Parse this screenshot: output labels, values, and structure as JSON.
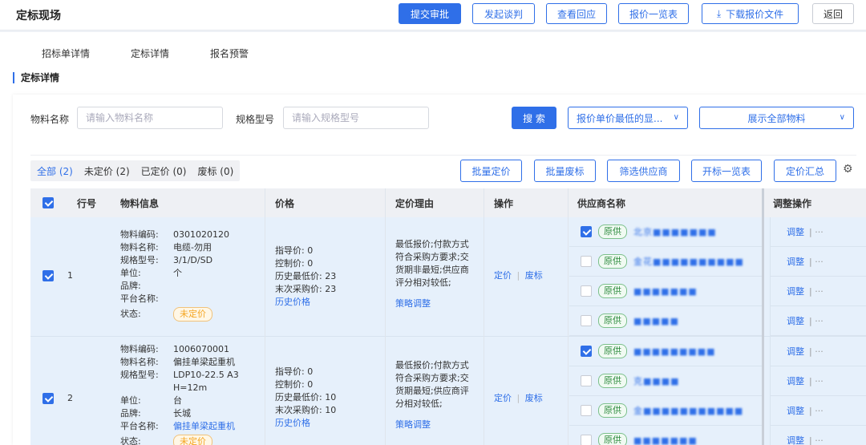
{
  "header": {
    "title": "定标现场",
    "buttons": {
      "submit": "提交审批",
      "negotiate": "发起谈判",
      "view_reply": "查看回应",
      "quote_list": "报价一览表",
      "download": "下载报价文件",
      "back": "返回"
    },
    "download_icon": "⤓"
  },
  "tabs": [
    "招标单详情",
    "定标详情",
    "报名预警"
  ],
  "section_title": "定标详情",
  "search": {
    "material_label": "物料名称",
    "material_placeholder": "请输入物料名称",
    "spec_label": "规格型号",
    "spec_placeholder": "请输入规格型号",
    "search_btn": "搜 索",
    "sort_select": "报价单价最低的显...",
    "show_select": "展示全部物料"
  },
  "filters": {
    "all": "全部 (2)",
    "unpriced": "未定价 (2)",
    "priced": "已定价 (0)",
    "void": "废标 (0)"
  },
  "actions": {
    "batch_price": "批量定价",
    "batch_void": "批量废标",
    "filter_supplier": "筛选供应商",
    "open_list": "开标一览表",
    "price_summary": "定价汇总"
  },
  "columns": {
    "row_no": "行号",
    "material": "物料信息",
    "price": "价格",
    "reason": "定价理由",
    "ops": "操作",
    "supplier": "供应商名称",
    "adjust": "调整操作"
  },
  "labels": {
    "code": "物料编码:",
    "name": "物料名称:",
    "spec": "规格型号:",
    "unit": "单位:",
    "brand": "品牌:",
    "platform": "平台名称:",
    "status": "状态:",
    "guide": "指导价:",
    "control": "控制价:",
    "hist_low": "历史最低价:",
    "last_buy": "末次采购价:",
    "hist_link": "历史价格",
    "strategy": "策略调整",
    "price_op": "定价",
    "sep": "|",
    "void_op": "废标",
    "orig_tag": "原供",
    "adjust": "调整",
    "more": "···"
  },
  "rows": [
    {
      "no": "1",
      "code": "0301020120",
      "name": "电缆-勿用",
      "spec": "3/1/D/SD",
      "unit": "个",
      "brand": "",
      "platform": "",
      "status": "未定价",
      "guide": "0",
      "control": "0",
      "hist_low": "23",
      "last_buy": "23",
      "reason": "最低报价;付款方式符合采购方要求;交货期非最短;供应商评分相对较低;",
      "suppliers": [
        "北京■■■■■■■",
        "金花■■■■■■■■■■",
        "■■■■■■■",
        "■■■■■"
      ]
    },
    {
      "no": "2",
      "code": "1006070001",
      "name": "偏挂单梁起重机",
      "spec": "LDP10-22.5 A3 H=12m",
      "unit": "台",
      "brand": "长城",
      "platform": "偏挂单梁起重机",
      "status": "未定价",
      "guide": "0",
      "control": "0",
      "hist_low": "10",
      "last_buy": "10",
      "reason": "最低报价;付款方式符合采购方要求;交货期最短;供应商评分相对较低;",
      "suppliers": [
        "■■■■■■■■■",
        "克■■■■",
        "金■■■■■■■■■■■",
        "■■■■■■■"
      ]
    }
  ],
  "icons": {
    "gear": "⚙",
    "chevron": "∨"
  }
}
